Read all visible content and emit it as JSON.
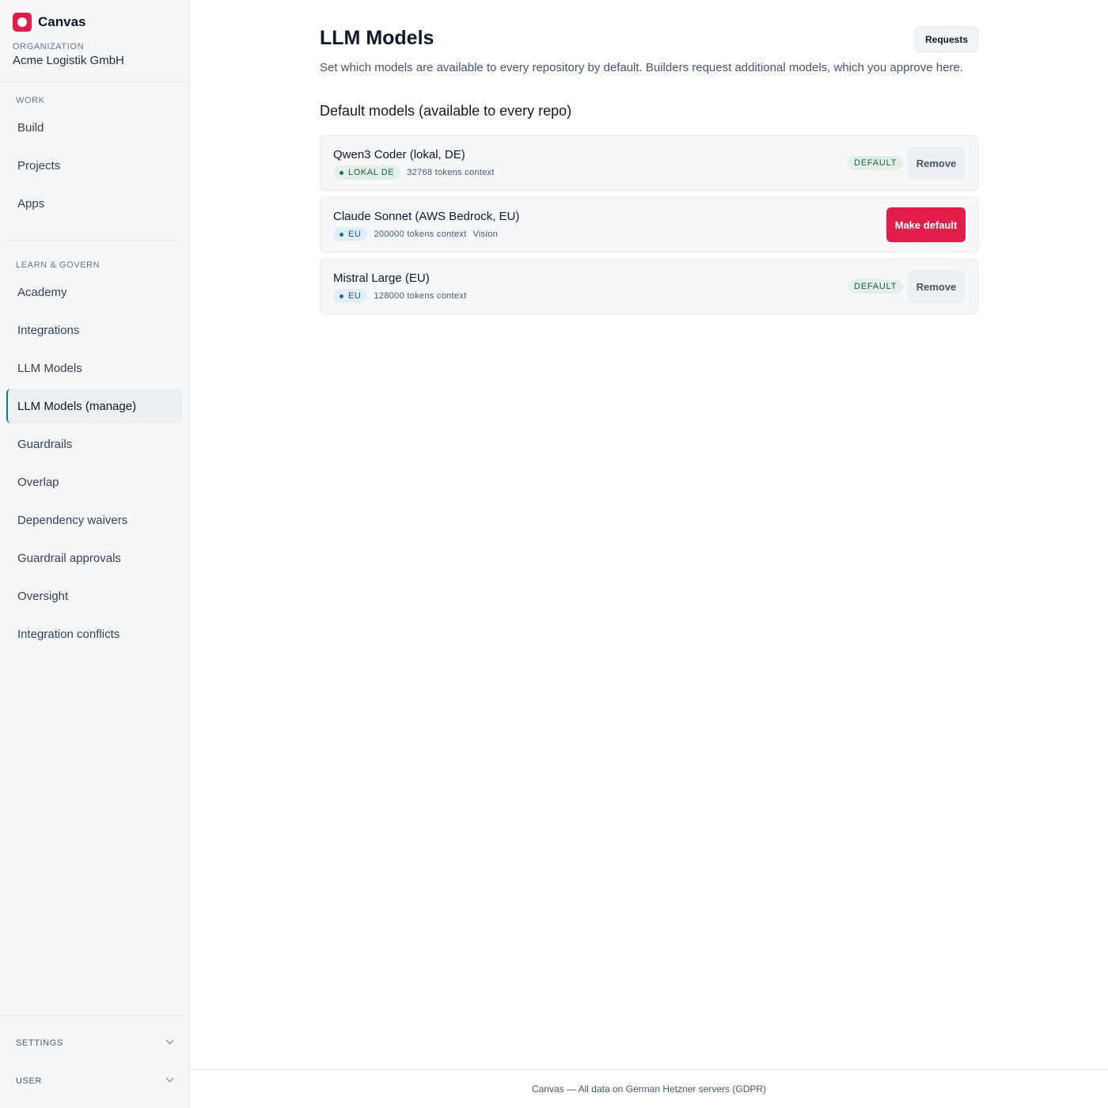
{
  "app": {
    "name": "Canvas",
    "brand_color": "#e11d48",
    "logo_icon": "record-icon"
  },
  "organization": {
    "label": "ORGANIZATION",
    "name": "Acme Logistik GmbH"
  },
  "sidebar": {
    "sections": [
      {
        "label": "WORK",
        "items": [
          {
            "label": "Build"
          },
          {
            "label": "Projects"
          },
          {
            "label": "Apps"
          }
        ]
      },
      {
        "label": "LEARN & GOVERN",
        "items": [
          {
            "label": "Academy"
          },
          {
            "label": "Integrations"
          },
          {
            "label": "LLM Models"
          },
          {
            "label": "LLM Models (manage)",
            "active": true
          },
          {
            "label": "Guardrails"
          },
          {
            "label": "Overlap"
          },
          {
            "label": "Dependency waivers"
          },
          {
            "label": "Guardrail approvals"
          },
          {
            "label": "Oversight"
          },
          {
            "label": "Integration conflicts"
          }
        ]
      }
    ],
    "collapsibles": [
      {
        "label": "SETTINGS",
        "icon": "chevron-down-icon"
      },
      {
        "label": "USER",
        "icon": "chevron-down-icon"
      }
    ]
  },
  "page": {
    "title": "LLM Models",
    "requests_label": "Requests",
    "description": "Set which models are available to every repository by default. Builders request additional models, which you approve here.",
    "section_title": "Default models (available to every repo)"
  },
  "models": [
    {
      "name": "Qwen3 Coder (lokal, DE)",
      "region": "LOKAL DE",
      "context": "32768 tokens context",
      "is_default": true,
      "default_badge": "DEFAULT",
      "action_label": "Remove"
    },
    {
      "name": "Claude Sonnet (AWS Bedrock, EU)",
      "region": "EU",
      "context": "200000 tokens context",
      "extra": "Vision",
      "is_default": false,
      "action_label": "Make default"
    },
    {
      "name": "Mistral Large (EU)",
      "region": "EU",
      "context": "128000 tokens context",
      "is_default": true,
      "default_badge": "DEFAULT",
      "action_label": "Remove"
    }
  ],
  "footer": {
    "text": "Canvas — All data on German Hetzner servers (GDPR)"
  }
}
